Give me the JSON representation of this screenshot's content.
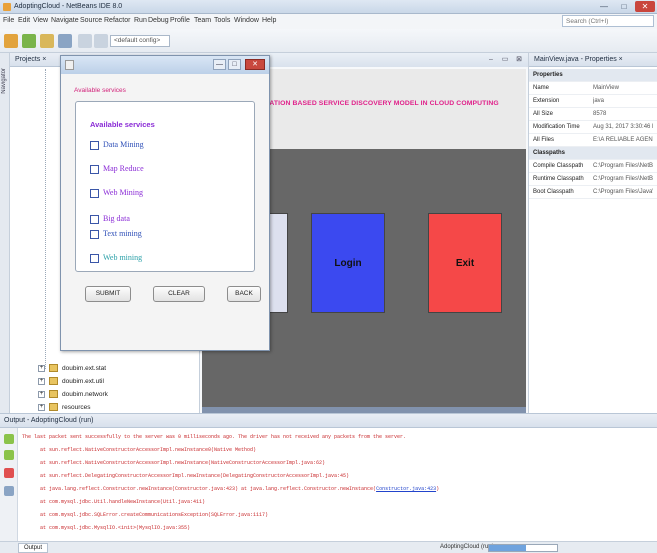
{
  "window": {
    "title": "AdoptingCloud - NetBeans IDE 8.0",
    "controls": [
      "—",
      "□",
      "✕"
    ]
  },
  "menu": [
    "File",
    "Edit",
    "View",
    "Navigate",
    "Source",
    "Refactor",
    "Run",
    "Debug",
    "Profile",
    "Team",
    "Tools",
    "Window",
    "Help"
  ],
  "search": {
    "placeholder": "Search (Ctrl+I)"
  },
  "toolbar": {
    "config_combo": "<default config>"
  },
  "left_strip": {
    "label": "Navigator"
  },
  "projects": {
    "tab_label": "Projects ×",
    "tree": [
      "doubim.ext.stat",
      "doubim.ext.util",
      "doubim.network",
      "resources"
    ]
  },
  "editor": {
    "controls": [
      "–",
      "▭",
      "⊠"
    ]
  },
  "app": {
    "heading": "AUTHENTICATION BASED SERVICE DISCOVERY MODEL IN CLOUD COMPUTING",
    "login": "Login",
    "exit": "Exit"
  },
  "properties": {
    "tab_label": "MainView.java - Properties ×",
    "rows": [
      {
        "k": "Properties",
        "v": "",
        "section": true
      },
      {
        "k": "Name",
        "v": "MainView"
      },
      {
        "k": "Extension",
        "v": "java"
      },
      {
        "k": "All Size",
        "v": "8578"
      },
      {
        "k": "Modification Time",
        "v": "Aug 31, 2017 3:30:46 PM"
      },
      {
        "k": "All Files",
        "v": "E:\\A RELIABLE AGENT ..."
      },
      {
        "k": "Classpaths",
        "v": "",
        "section": true
      },
      {
        "k": "Compile Classpath",
        "v": "C:\\Program Files\\NetBe..."
      },
      {
        "k": "Runtime Classpath",
        "v": "C:\\Program Files\\NetBe..."
      },
      {
        "k": "Boot Classpath",
        "v": "C:\\Program Files\\Java\\..."
      }
    ]
  },
  "dialog": {
    "controls": {
      "min": "—",
      "max": "□",
      "close": "✕"
    },
    "label": "Available services",
    "box_title": "Available services",
    "colors": {
      "accent": "#8a2bd6",
      "label": "#d2227a"
    },
    "services": [
      {
        "label": "Data Mining",
        "color": "#2f50b8"
      },
      {
        "label": "Map Reduce",
        "color": "#8a2bd6"
      },
      {
        "label": "Web Mining",
        "color": "#8a2bd6"
      },
      {
        "label": "Big data",
        "color": "#8a2bd6"
      },
      {
        "label": "Text mining",
        "color": "#2f50b8"
      },
      {
        "label": "Web mining",
        "color": "#2aa0a8"
      }
    ],
    "buttons": {
      "submit": "SUBMIT",
      "clear": "CLEAR",
      "back": "BACK"
    }
  },
  "output": {
    "tab_label": "Output - AdoptingCloud (run)",
    "lines": [
      "The last packet sent successfully to the server was 0 milliseconds ago. The driver has not received any packets from the server.",
      "at sun.reflect.NativeConstructorAccessorImpl.newInstance0(Native Method)",
      "at sun.reflect.NativeConstructorAccessorImpl.newInstance(NativeConstructorAccessorImpl.java:62)",
      "at sun.reflect.DelegatingConstructorAccessorImpl.newInstance(DelegatingConstructorAccessorImpl.java:45)",
      "at java.lang.reflect.Constructor.newInstance(Constructor.java:423)       at java.lang.reflect.Constructor.newInstance(",
      "at com.mysql.jdbc.Util.handleNewInstance(Util.java:411)",
      "at com.mysql.jdbc.SQLError.createCommunicationsException(SQLError.java:1117)",
      "at com.mysql.jdbc.MysqlIO.<init>(MysqlIO.java:355)"
    ],
    "link_text": "Constructor.java:423"
  },
  "status": {
    "output_tab": "Output",
    "project": "AdoptingCloud (run)",
    "progress": 0.55
  }
}
